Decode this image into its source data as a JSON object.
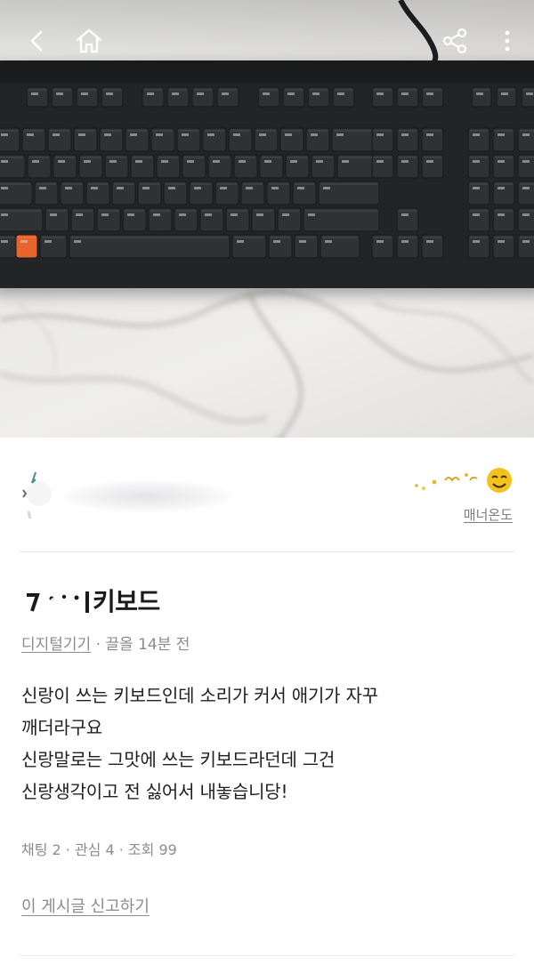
{
  "nav": {
    "back_icon": "chevron-left-icon",
    "home_icon": "home-icon",
    "share_icon": "share-icon",
    "more_icon": "more-vertical-icon"
  },
  "profile": {
    "manner_link": "매너온도"
  },
  "post": {
    "title_visible": "키보드",
    "category": "디지털기기",
    "meta_rest": "· 끌올 14분 전",
    "body_lines": [
      "신랑이 쓰는 키보드인데 소리가 커서 애기가 자꾸",
      "깨더라구요",
      "신랑말로는 그맛에 쓰는 키보드라던데 그건",
      "신랑생각이고 전 싫어서 내놓습니당!"
    ],
    "stats": "채팅 2 · 관심 4 · 조회 99",
    "report_link": "이 게시글 신고하기"
  },
  "colors": {
    "keyboard": "#222426",
    "accent_key": "#e8642c",
    "muted_text": "#8b8b90",
    "manner_face": "#f3c21b"
  }
}
